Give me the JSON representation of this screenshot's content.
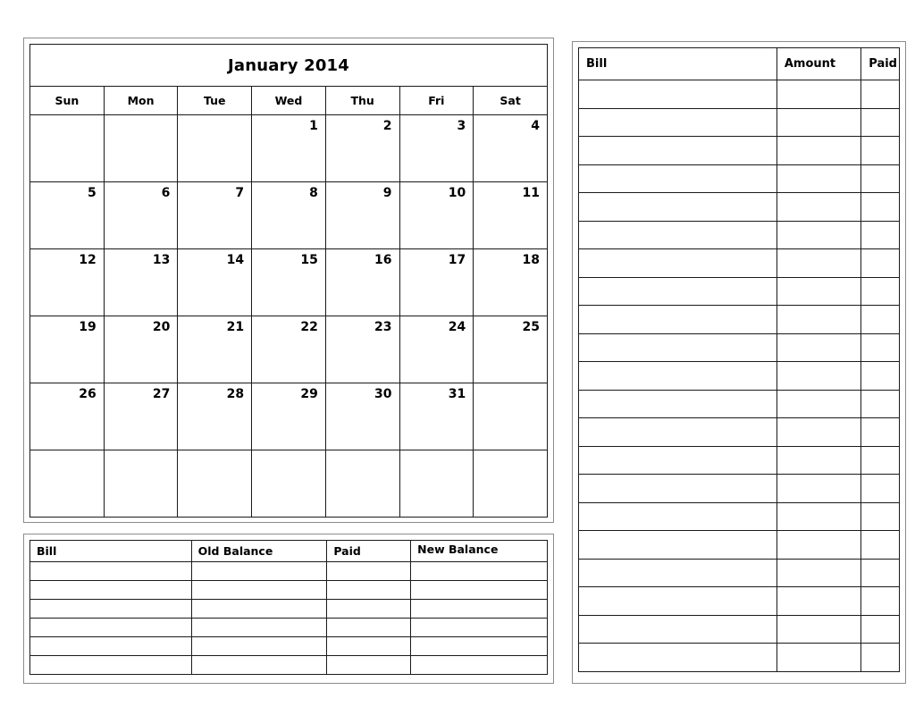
{
  "calendar": {
    "title": "January 2014",
    "weekdays": [
      "Sun",
      "Mon",
      "Tue",
      "Wed",
      "Thu",
      "Fri",
      "Sat"
    ],
    "weeks": [
      [
        "",
        "",
        "",
        "1",
        "2",
        "3",
        "4"
      ],
      [
        "5",
        "6",
        "7",
        "8",
        "9",
        "10",
        "11"
      ],
      [
        "12",
        "13",
        "14",
        "15",
        "16",
        "17",
        "18"
      ],
      [
        "19",
        "20",
        "21",
        "22",
        "23",
        "24",
        "25"
      ],
      [
        "26",
        "27",
        "28",
        "29",
        "30",
        "31",
        ""
      ],
      [
        "",
        "",
        "",
        "",
        "",
        "",
        ""
      ]
    ]
  },
  "balance_table": {
    "headers": [
      "Bill",
      "Old Balance",
      "Paid",
      "New Balance"
    ],
    "rows": [
      [
        "",
        "",
        "",
        ""
      ],
      [
        "",
        "",
        "",
        ""
      ],
      [
        "",
        "",
        "",
        ""
      ],
      [
        "",
        "",
        "",
        ""
      ],
      [
        "",
        "",
        "",
        ""
      ],
      [
        "",
        "",
        "",
        ""
      ]
    ]
  },
  "bills_table": {
    "headers": [
      "Bill",
      "Amount",
      "Paid"
    ],
    "rows": [
      [
        "",
        "",
        ""
      ],
      [
        "",
        "",
        ""
      ],
      [
        "",
        "",
        ""
      ],
      [
        "",
        "",
        ""
      ],
      [
        "",
        "",
        ""
      ],
      [
        "",
        "",
        ""
      ],
      [
        "",
        "",
        ""
      ],
      [
        "",
        "",
        ""
      ],
      [
        "",
        "",
        ""
      ],
      [
        "",
        "",
        ""
      ],
      [
        "",
        "",
        ""
      ],
      [
        "",
        "",
        ""
      ],
      [
        "",
        "",
        ""
      ],
      [
        "",
        "",
        ""
      ],
      [
        "",
        "",
        ""
      ],
      [
        "",
        "",
        ""
      ],
      [
        "",
        "",
        ""
      ],
      [
        "",
        "",
        ""
      ],
      [
        "",
        "",
        ""
      ],
      [
        "",
        "",
        ""
      ],
      [
        "",
        "",
        ""
      ]
    ]
  }
}
